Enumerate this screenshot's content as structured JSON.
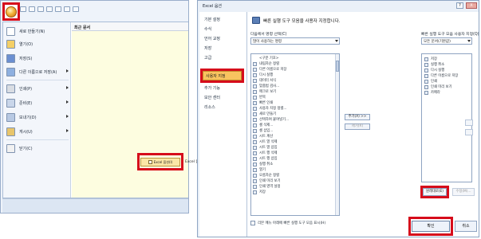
{
  "office_menu": {
    "menu_items": [
      {
        "label": "새로 만들기(N)",
        "icon": "new-document-icon",
        "has_submenu": false
      },
      {
        "label": "열기(O)",
        "icon": "open-folder-icon",
        "has_submenu": false
      },
      {
        "label": "저장(S)",
        "icon": "save-icon",
        "has_submenu": false
      },
      {
        "label": "다른 이름으로 저장(A)",
        "icon": "save-as-icon",
        "has_submenu": true
      },
      {
        "label": "인쇄(P)",
        "icon": "print-icon",
        "has_submenu": true
      },
      {
        "label": "준비(E)",
        "icon": "prepare-icon",
        "has_submenu": true
      },
      {
        "label": "보내기(D)",
        "icon": "send-icon",
        "has_submenu": true
      },
      {
        "label": "게시(U)",
        "icon": "publish-icon",
        "has_submenu": true
      },
      {
        "label": "닫기(C)",
        "icon": "close-doc-icon",
        "has_submenu": false
      }
    ],
    "recent_title": "최근 문서",
    "options_button": "Excel 옵션(I)",
    "exit_button": "Excel 끝내기(X)"
  },
  "dialog": {
    "title": "Excel 옵션",
    "help": "?",
    "close": "X",
    "nav_items": [
      "기본 설정",
      "수식",
      "언어 교정",
      "저장",
      "고급",
      "사용자 지정",
      "추가 기능",
      "보안 센터",
      "리소스"
    ],
    "active_nav": "사용자 지정",
    "header": "빠른 실행 도구 모음을 사용자 지정합니다.",
    "choose_label": "다음에서 명령 선택(C)",
    "choose_value": "많이 사용하는 명령",
    "customize_label": "빠른 실행 도구 모음 사용자 지정(Q)",
    "customize_value": "모든 문서(기본값)",
    "commands": [
      "<구분 기호>",
      "내림차순 정렬",
      "다른 이름으로 저장",
      "다시 실행",
      "데이터 서식",
      "맞춤법 검사...",
      "매크로 보기",
      "반복",
      "빠른 인쇄",
      "사용자 지정 정렬...",
      "새로 만들기",
      "선택하여 붙여넣기...",
      "셀 삭제...",
      "셀 삽입...",
      "시트 계산",
      "시트 열 삭제",
      "시트 열 삽입",
      "시트 행 삭제",
      "시트 행 삽입",
      "실행 취소",
      "열기",
      "오름차순 정렬",
      "인쇄 미리 보기",
      "인쇄 영역 설정",
      "저장"
    ],
    "qat_items": [
      "저장",
      "실행 취소",
      "다시 실행",
      "다른 이름으로 저장",
      "인쇄",
      "인쇄 미리 보기",
      "카메라"
    ],
    "add_button": "추가(A) >>",
    "remove_button": "제거(R)",
    "reset_button": "원래대로(E)",
    "modify_button": "수정(M)...",
    "show_below": "리본 메뉴 아래에 빠른 실행 도구 모음 표시(H)",
    "ok_button": "확인",
    "cancel_button": "취소"
  },
  "colors": {
    "highlight_red": "#d60c1b",
    "active_nav_orange": "#f8c35f",
    "recent_yellow": "#fdfde0"
  }
}
